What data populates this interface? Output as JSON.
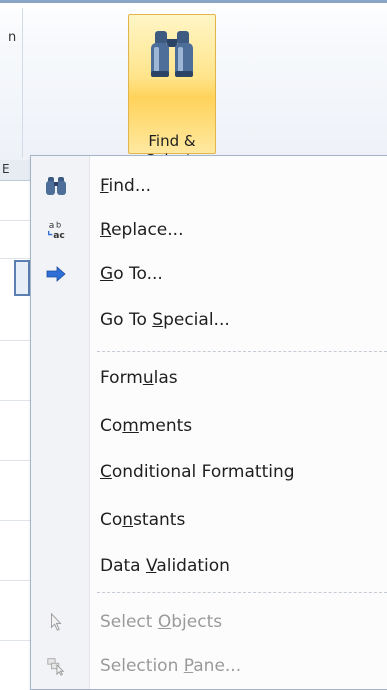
{
  "ribbon": {
    "left_fragment": "n",
    "sheet_column_fragment": "E",
    "find_select": {
      "line1": "Find &",
      "line2": "Select",
      "caret": "▾",
      "icon": "binoculars-icon"
    }
  },
  "menu": {
    "items": [
      {
        "label": "Find...",
        "icon": "binoculars-icon",
        "mnemonic": "F",
        "enabled": true
      },
      {
        "label": "Replace...",
        "icon": "replace-icon",
        "mnemonic": "R",
        "enabled": true
      },
      {
        "label": "Go To...",
        "icon": "arrow-right-icon",
        "mnemonic": "G",
        "enabled": true
      },
      {
        "label": "Go To Special...",
        "icon": "",
        "mnemonic": "S",
        "enabled": true
      },
      {
        "label": "Formulas",
        "icon": "",
        "mnemonic": "u",
        "enabled": true
      },
      {
        "label": "Comments",
        "icon": "",
        "mnemonic": "m",
        "enabled": true
      },
      {
        "label": "Conditional Formatting",
        "icon": "",
        "mnemonic": "C",
        "enabled": true
      },
      {
        "label": "Constants",
        "icon": "",
        "mnemonic": "n",
        "enabled": true
      },
      {
        "label": "Data Validation",
        "icon": "",
        "mnemonic": "V",
        "enabled": true
      },
      {
        "label": "Select Objects",
        "icon": "cursor-arrow-icon",
        "mnemonic": "O",
        "enabled": false
      },
      {
        "label": "Selection Pane...",
        "icon": "selection-pane-icon",
        "mnemonic": "P",
        "enabled": false
      }
    ]
  },
  "colors": {
    "button_highlight": "#ffd35b",
    "menu_border": "#a3b4c8",
    "disabled_text": "#9a9a9a",
    "arrow_blue": "#2f6fd6"
  }
}
